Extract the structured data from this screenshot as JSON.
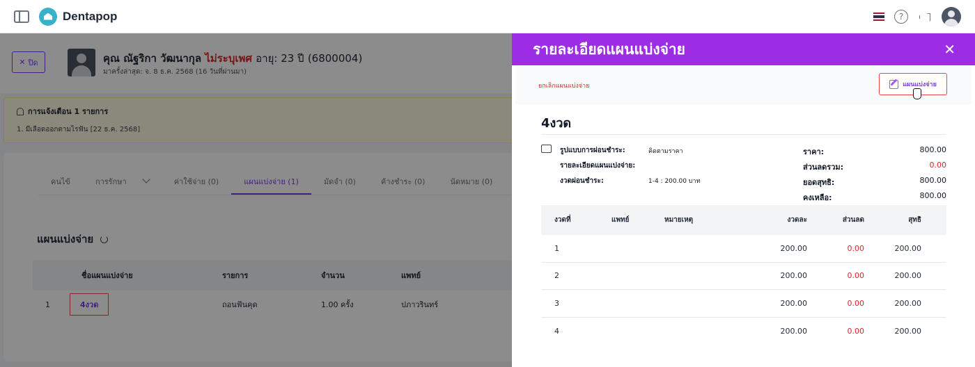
{
  "app": {
    "brand": "Dentapop"
  },
  "patient": {
    "close_label": "ปิด",
    "name": "คุณ ณัฐริกา วัฒนากุล",
    "gender": "ไม่ระบุเพศ",
    "age": "อายุ: 23 ปี",
    "hn": "(6800004)",
    "last_visit": "มาครั้งล่าสุด: จ. 8 ธ.ค. 2568 (16 วันที่ผ่านมา)"
  },
  "alert": {
    "title": "การแจ้งเตือน 1 รายการ",
    "item": "1. มีเลือดออกตามไรฟัน [22 ธ.ค. 2568]"
  },
  "tabs": [
    {
      "label": "คนไข้"
    },
    {
      "label": "การรักษา"
    },
    {
      "label": "ค่าใช้จ่าย (0)"
    },
    {
      "label": "แผนแบ่งจ่าย (1)"
    },
    {
      "label": "มัดจำ (0)"
    },
    {
      "label": "ค้างชำระ (0)"
    },
    {
      "label": "นัดหมาย (0)"
    }
  ],
  "plan_section": {
    "title": "แผนแบ่งจ่าย",
    "columns": [
      "",
      "ชื่อแผนแบ่งจ่าย",
      "รายการ",
      "จำนวน",
      "แพทย์"
    ],
    "rows": [
      {
        "no": "1",
        "name": "4งวด",
        "item": "ถอนฟันคุด",
        "qty": "1.00 ครั้ง",
        "doctor": "ปภาวรินทร์"
      }
    ]
  },
  "drawer": {
    "title": "รายละเอียดแผนแบ่งจ่าย",
    "cancel_label": "ยกเลิกแผนแบ่งจ่าย",
    "edit_label": "แผนแบ่งจ่าย",
    "plan_name": "4งวด",
    "info": {
      "payment_type_label": "รูปแบบการผ่อนชำระ:",
      "payment_type_value": "คิดตามราคา",
      "detail_label": "รายละเอียดแผนแบ่งจ่าย:",
      "installments_label": "งวดผ่อนชำระ:",
      "installments_value": "1-4 :  200.00 บาท"
    },
    "summary": {
      "price_label": "ราคา:",
      "price": "800.00",
      "discount_label": "ส่วนลดรวม:",
      "discount": "0.00",
      "net_label": "ยอดสุทธิ:",
      "net": "800.00",
      "remaining_label": "คงเหลือ:",
      "remaining": "800.00"
    },
    "columns": [
      "งวดที่",
      "แพทย์",
      "หมายเหตุ",
      "งวดละ",
      "ส่วนลด",
      "สุทธิ"
    ],
    "rows": [
      {
        "no": "1",
        "doctor": "",
        "note": "",
        "amount": "200.00",
        "discount": "0.00",
        "net": "200.00"
      },
      {
        "no": "2",
        "doctor": "",
        "note": "",
        "amount": "200.00",
        "discount": "0.00",
        "net": "200.00"
      },
      {
        "no": "3",
        "doctor": "",
        "note": "",
        "amount": "200.00",
        "discount": "0.00",
        "net": "200.00"
      },
      {
        "no": "4",
        "doctor": "",
        "note": "",
        "amount": "200.00",
        "discount": "0.00",
        "net": "200.00"
      }
    ]
  },
  "colors": {
    "accent": "#9d2de5",
    "danger": "#dc2626"
  }
}
